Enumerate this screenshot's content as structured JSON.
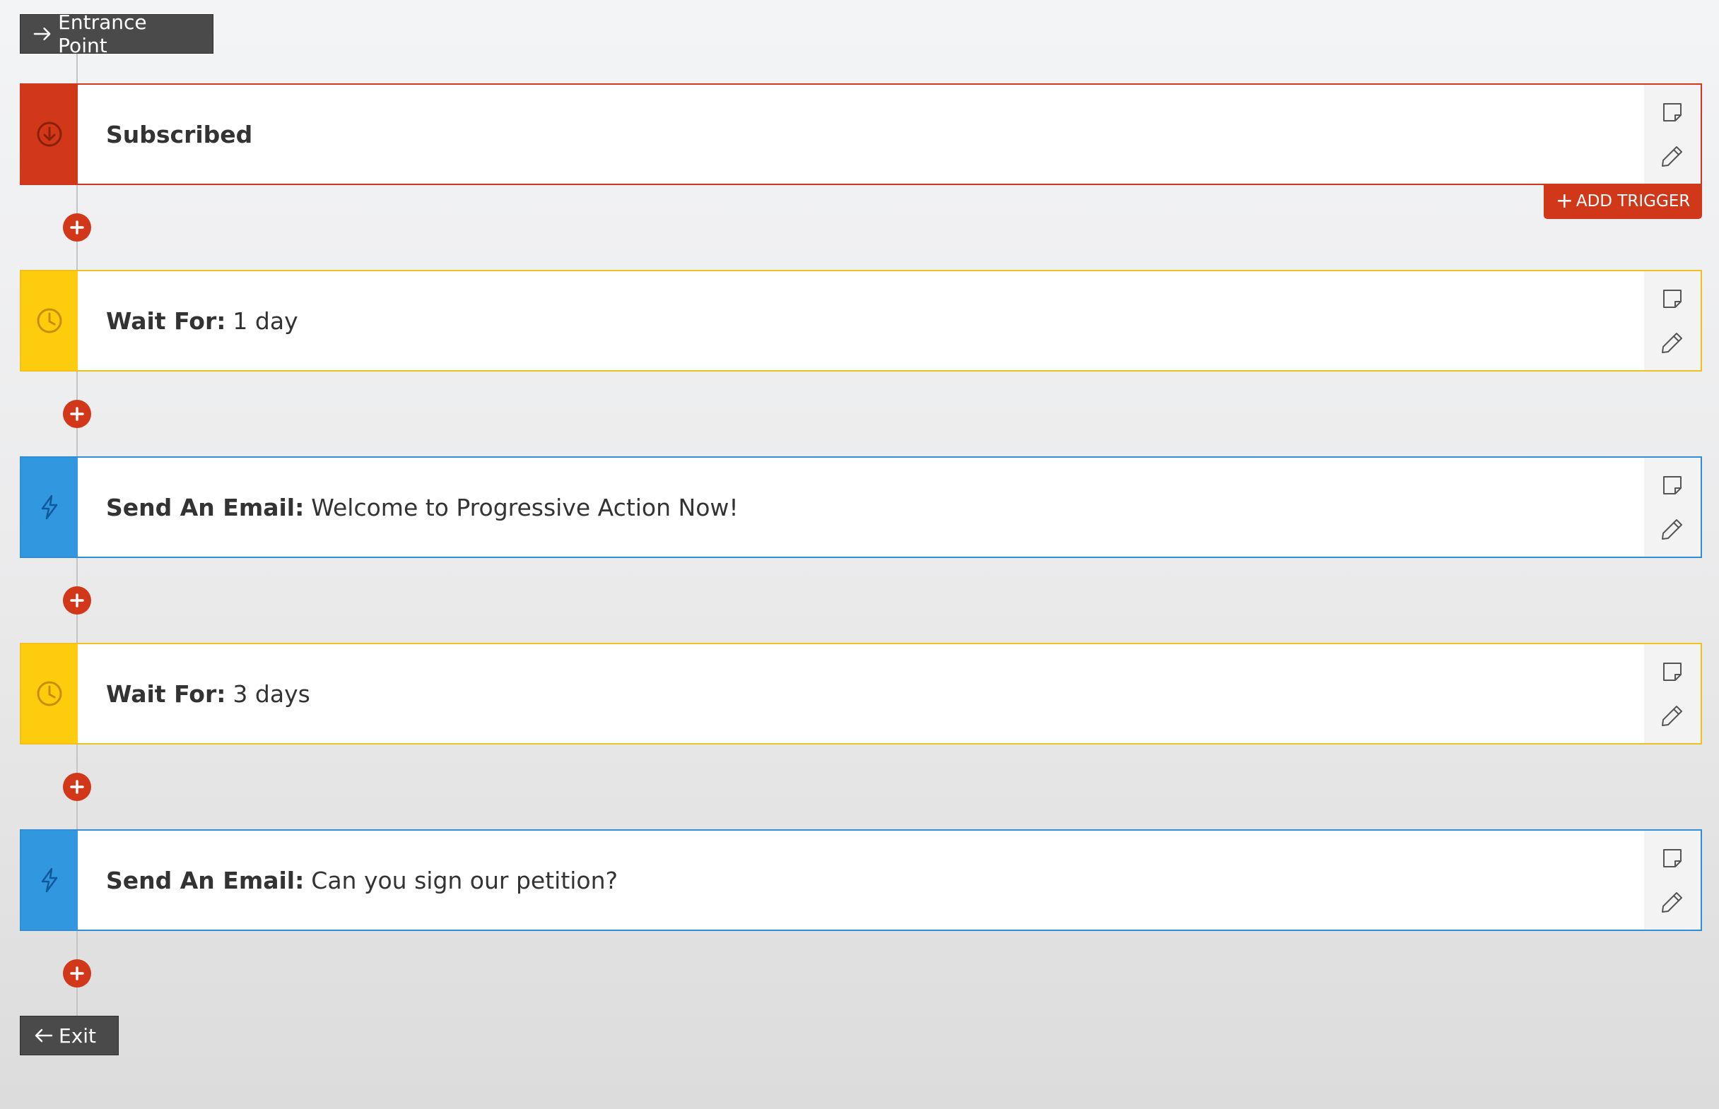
{
  "entrance": {
    "label": "Entrance Point"
  },
  "exit": {
    "label": "Exit"
  },
  "add_trigger": {
    "label": "ADD TRIGGER"
  },
  "steps": [
    {
      "kind": "trigger",
      "title": "Subscribed",
      "detail": ""
    },
    {
      "kind": "wait",
      "title": "Wait For:",
      "detail": "1 day"
    },
    {
      "kind": "email",
      "title": "Send An Email:",
      "detail": "Welcome to Progressive Action Now!"
    },
    {
      "kind": "wait",
      "title": "Wait For:",
      "detail": "3 days"
    },
    {
      "kind": "email",
      "title": "Send An Email:",
      "detail": "Can you sign our petition?"
    }
  ],
  "colors": {
    "trigger": "#d13719",
    "wait": "#fdcc0d",
    "email": "#3198e0",
    "plus": "#d13719",
    "dark_pill": "#4a4a4a"
  },
  "icons": {
    "trigger": "arrow-down-circle-icon",
    "wait": "clock-icon",
    "email": "lightning-bolt-icon",
    "note": "note-icon",
    "edit": "pencil-icon",
    "add": "plus-circle-icon"
  }
}
